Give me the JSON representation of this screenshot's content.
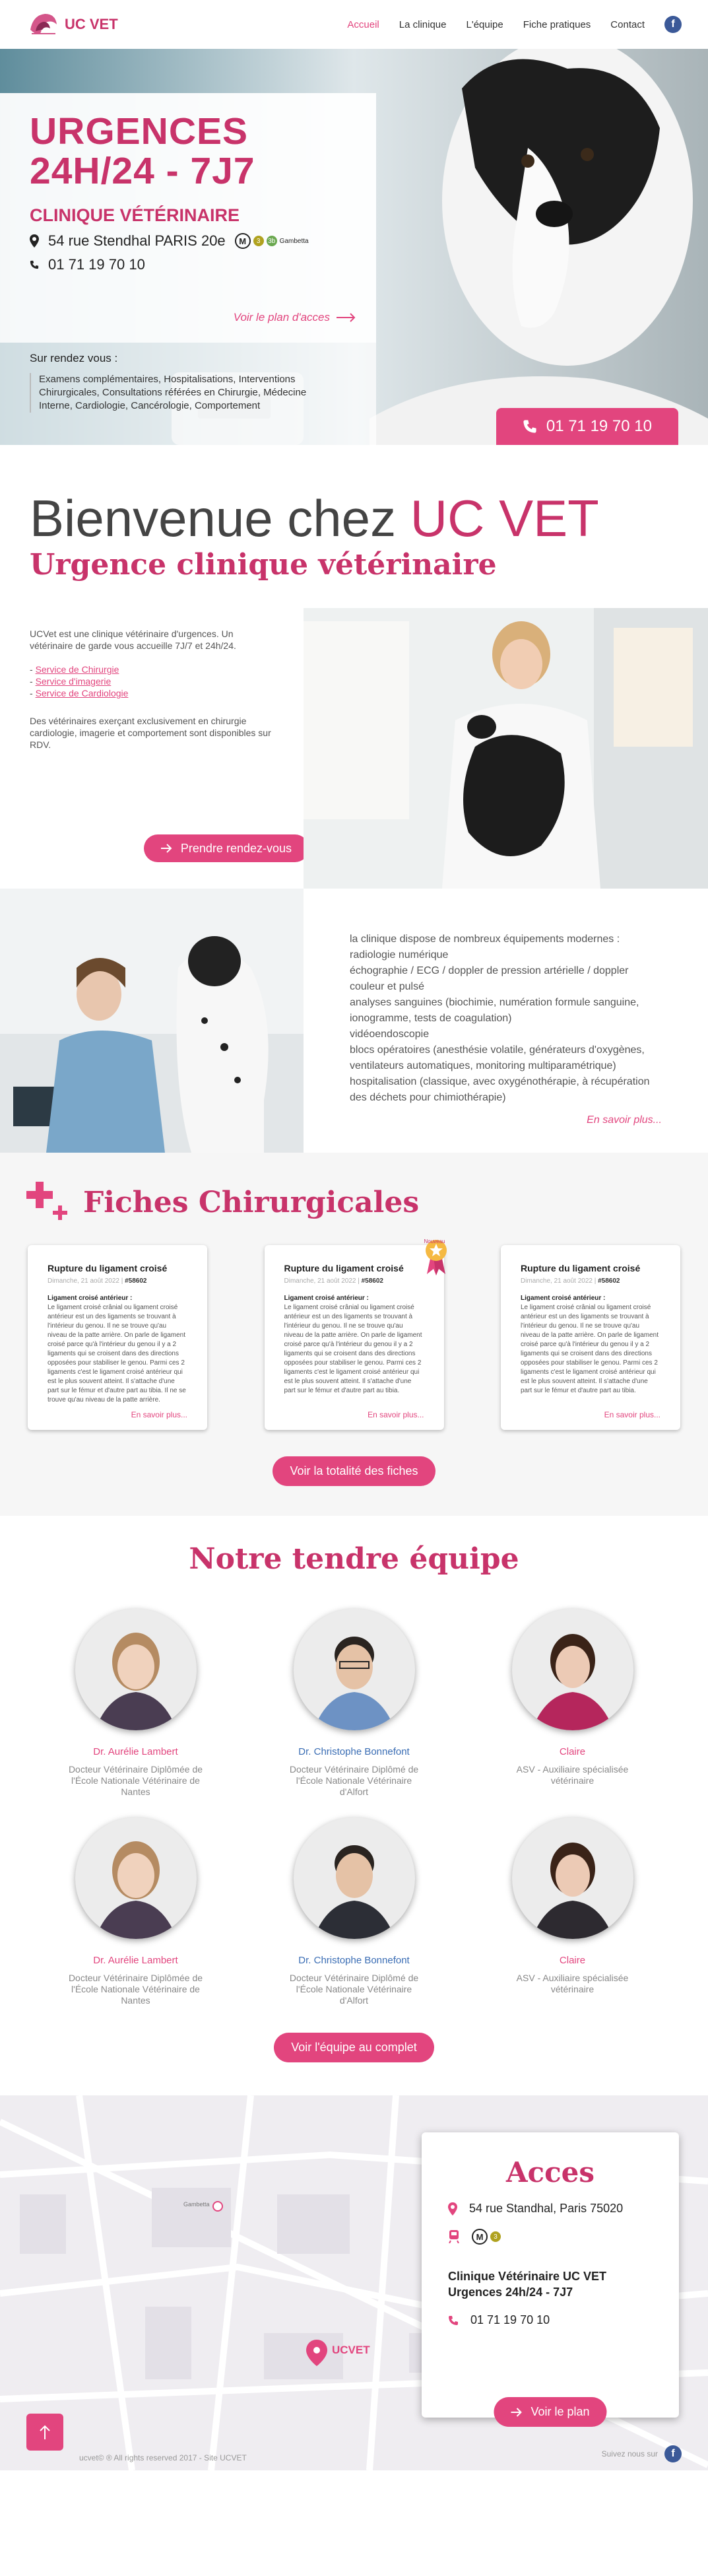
{
  "nav": {
    "logo_text": "UC VET",
    "items": [
      "Accueil",
      "La clinique",
      "L'équipe",
      "Fiche pratiques",
      "Contact"
    ],
    "facebook": "f"
  },
  "hero": {
    "title_line1": "URGENCES",
    "title_line2": "24H/24 - 7J7",
    "subtitle": "CLINIQUE VÉTÉRINAIRE",
    "address": "54 rue Stendhal PARIS 20e",
    "metro": "M",
    "metro_lines": [
      "3",
      "3b"
    ],
    "metro_station": "Gambetta",
    "phone": "01 71 19 70 10",
    "plan_link": "Voir le plan d'acces",
    "rdv_title": "Sur rendez vous :",
    "rdv_list": "Examens complémentaires, Hospitalisations, Interventions Chirurgicales, Consultations référées en Chirurgie, Médecine Interne, Cardiologie, Cancérologie, Comportement",
    "cta_phone": "01 71 19 70 10"
  },
  "welcome": {
    "title_plain": "Bienvenue chez ",
    "title_accent": "UC VET",
    "subtitle": "Urgence clinique vétérinaire"
  },
  "intro": {
    "p1": "UCVet est une clinique vétérinaire d'urgences. Un vétérinaire de garde vous accueille 7J/7 et 24h/24.",
    "services": [
      "Service de Chirurgie",
      "Service d'imagerie",
      "Service de Cardiologie"
    ],
    "p2": "Des vétérinaires exerçant exclusivement en chirurgie cardiologie, imagerie et comportement sont disponibles sur RDV.",
    "button": "Prendre rendez-vous"
  },
  "equipment": {
    "lines": [
      "la clinique dispose de nombreux équipements modernes :",
      "radiologie numérique",
      "échographie / ECG / doppler de pression artérielle / doppler couleur et pulsé",
      "analyses sanguines (biochimie, numération formule sanguine, ionogramme, tests de coagulation)",
      "vidéoendoscopie",
      "blocs opératoires (anesthésie volatile, générateurs d'oxygènes, ventilateurs automatiques, monitoring multiparamétrique)",
      "hospitalisation (classique, avec oxygénothérapie, à récupération des déchets pour chimiothérapie)"
    ],
    "more": "En savoir plus..."
  },
  "fiches": {
    "title": "Fiches Chirurgicales",
    "cards": [
      {
        "title": "Rupture du ligament croisé",
        "date": "Dimanche, 21 août 2022",
        "tag": "#58602",
        "sub": "Ligament croisé antérieur :",
        "body": "Le ligament croisé crânial ou ligament croisé antérieur est un des ligaments se trouvant à l'intérieur du genou. Il ne se trouve qu'au niveau de la patte arrière. On parle de ligament croisé parce qu'à l'intérieur du genou il y a 2 ligaments qui se croisent dans des directions opposées pour stabiliser le genou. Parmi ces 2 ligaments c'est le ligament croisé antérieur qui est le plus souvent atteint. Il s'attache d'une part sur le fémur et d'autre part au tibia. Il ne se trouve qu'au niveau de la patte arrière.",
        "more": "En savoir plus..."
      },
      {
        "title": "Rupture du ligament croisé",
        "date": "Dimanche, 21 août 2022",
        "tag": "#58602",
        "sub": "Ligament croisé antérieur :",
        "body": "Le ligament croisé crânial ou ligament croisé antérieur est un des ligaments se trouvant à l'intérieur du genou. Il ne se trouve qu'au niveau de la patte arrière. On parle de ligament croisé parce qu'à l'intérieur du genou il y a 2 ligaments qui se croisent dans des directions opposées pour stabiliser le genou. Parmi ces 2 ligaments c'est le ligament croisé antérieur qui est le plus souvent atteint. Il s'attache d'une part sur le fémur et d'autre part au tibia.",
        "more": "En savoir plus...",
        "badge": "Nouveau"
      },
      {
        "title": "Rupture du ligament croisé",
        "date": "Dimanche, 21 août 2022",
        "tag": "#58602",
        "sub": "Ligament croisé antérieur :",
        "body": "Le ligament croisé crânial ou ligament croisé antérieur est un des ligaments se trouvant à l'intérieur du genou. Il ne se trouve qu'au niveau de la patte arrière. On parle de ligament croisé parce qu'à l'intérieur du genou il y a 2 ligaments qui se croisent dans des directions opposées pour stabiliser le genou. Parmi ces 2 ligaments c'est le ligament croisé antérieur qui est le plus souvent atteint. Il s'attache d'une part sur le fémur et d'autre part au tibia.",
        "more": "En savoir plus..."
      }
    ],
    "button": "Voir la totalité des fiches"
  },
  "team": {
    "title": "Notre tendre équipe",
    "members": [
      {
        "name": "Dr. Aurélie Lambert",
        "desc": "Docteur Vétérinaire Diplômée de l'École Nationale Vétérinaire de Nantes",
        "color": "pink"
      },
      {
        "name": "Dr. Christophe Bonnefont",
        "desc": "Docteur Vétérinaire Diplômé de l'École Nationale Vétérinaire d'Alfort",
        "color": "blue"
      },
      {
        "name": "Claire",
        "desc": "ASV - Auxiliaire spécialisée vétérinaire",
        "color": "pink"
      },
      {
        "name": "Dr. Aurélie Lambert",
        "desc": "Docteur Vétérinaire Diplômée de l'École Nationale Vétérinaire de Nantes",
        "color": "pink"
      },
      {
        "name": "Dr. Christophe Bonnefont",
        "desc": "Docteur Vétérinaire Diplômé de l'École Nationale Vétérinaire d'Alfort",
        "color": "blue"
      },
      {
        "name": "Claire",
        "desc": "ASV - Auxiliaire spécialisée vétérinaire",
        "color": "pink"
      }
    ],
    "button": "Voir l'équipe au complet"
  },
  "acces": {
    "title": "Acces",
    "address": "54 rue Standhal, Paris 75020",
    "metro": "M",
    "metro_line": "3",
    "clinic_name": "Clinique Vétérinaire UC VET",
    "hours": "Urgences 24h/24 - 7J7",
    "phone": "01 71 19 70 10",
    "button": "Voir le plan",
    "map_label": "UCVET",
    "map_station": "Gambetta"
  },
  "footer": {
    "copyright": "ucvet© ® All rights reserved 2017 - Site UCVET",
    "follow": "Suivez nous sur"
  },
  "colors": {
    "accent": "#e2457e",
    "brand": "#c8336a",
    "facebook": "#3b5998"
  }
}
